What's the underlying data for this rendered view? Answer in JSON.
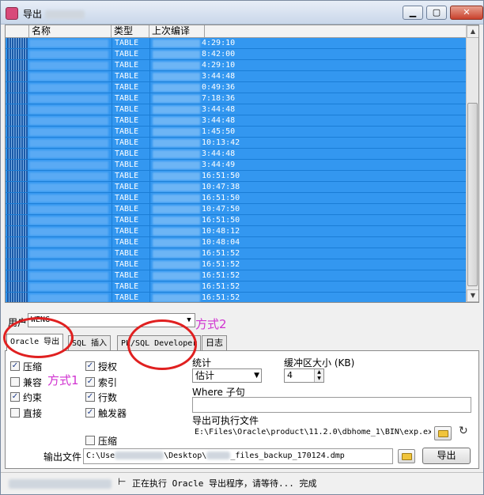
{
  "window": {
    "title": "导出",
    "icon": "oracle-export-app-icon",
    "buttons": [
      "minimize",
      "maximize",
      "close"
    ]
  },
  "grid": {
    "columns": [
      "名称",
      "类型",
      "上次编译"
    ],
    "rows": [
      {
        "type": "TABLE",
        "time": "4:29:10"
      },
      {
        "type": "TABLE",
        "time": "8:42:00"
      },
      {
        "type": "TABLE",
        "time": "4:29:10"
      },
      {
        "type": "TABLE",
        "time": "3:44:48"
      },
      {
        "type": "TABLE",
        "time": "0:49:36"
      },
      {
        "type": "TABLE",
        "time": "7:18:36"
      },
      {
        "type": "TABLE",
        "time": "3:44:48"
      },
      {
        "type": "TABLE",
        "time": "3:44:48"
      },
      {
        "type": "TABLE",
        "time": "1:45:50"
      },
      {
        "type": "TABLE",
        "time": "10:13:42"
      },
      {
        "type": "TABLE",
        "time": "3:44:48"
      },
      {
        "type": "TABLE",
        "time": "3:44:49"
      },
      {
        "type": "TABLE",
        "time": "16:51:50"
      },
      {
        "type": "TABLE",
        "time": "10:47:38"
      },
      {
        "type": "TABLE",
        "time": "16:51:50"
      },
      {
        "type": "TABLE",
        "time": "10:47:50"
      },
      {
        "type": "TABLE",
        "time": "16:51:50"
      },
      {
        "type": "TABLE",
        "time": "10:48:12"
      },
      {
        "type": "TABLE",
        "time": "10:48:04"
      },
      {
        "type": "TABLE",
        "time": "16:51:52"
      },
      {
        "type": "TABLE",
        "time": "16:51:52"
      },
      {
        "type": "TABLE",
        "time": "16:51:52"
      },
      {
        "type": "TABLE",
        "time": "16:51:52"
      },
      {
        "type": "TABLE",
        "time": "16:51:52"
      }
    ]
  },
  "user": {
    "label": "用户",
    "value": "WENG"
  },
  "annotations": {
    "method1": "方式1",
    "method2": "方式2"
  },
  "tabs": [
    "Oracle 导出",
    "SQL 插入",
    "PL/SQL Developer",
    "日志"
  ],
  "options": {
    "col1": [
      {
        "label": "压缩",
        "checked": true
      },
      {
        "label": "兼容",
        "checked": false
      },
      {
        "label": "约束",
        "checked": true
      },
      {
        "label": "直接",
        "checked": false
      }
    ],
    "col2": [
      {
        "label": "授权",
        "checked": true
      },
      {
        "label": "索引",
        "checked": true
      },
      {
        "label": "行数",
        "checked": true
      },
      {
        "label": "触发器",
        "checked": true
      }
    ],
    "compress_bottom": {
      "label": "压缩",
      "checked": false
    }
  },
  "statistics": {
    "label": "统计",
    "value": "估计"
  },
  "buffer": {
    "label": "缓冲区大小 (KB)",
    "value": "4"
  },
  "where": {
    "label": "Where 子句",
    "value": ""
  },
  "executable": {
    "label": "导出可执行文件",
    "value": "E:\\Files\\Oracle\\product\\11.2.0\\dbhome_1\\BIN\\exp.exe"
  },
  "output": {
    "label": "输出文件",
    "value_prefix": "C:\\Use",
    "value_mid": "\\Desktop\\",
    "value_suffix": "_files_backup_170124.dmp"
  },
  "export_button": "导出",
  "status": {
    "text": "正在执行 Oracle 导出程序，请等待... 完成"
  },
  "colors": {
    "selection": "#3397f0",
    "annotation": "#d032d0",
    "highlight_circle": "#e02020"
  }
}
